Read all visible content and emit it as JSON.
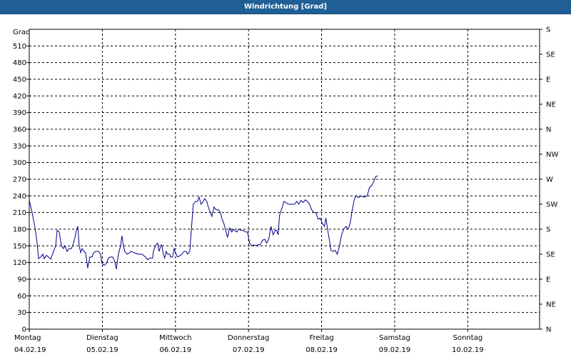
{
  "window": {
    "title": "Windrichtung [Grad]"
  },
  "colors": {
    "titlebar": "#1f5f95",
    "line": "#00008b",
    "grid": "#000000",
    "background": "#ffffff"
  },
  "chart_data": {
    "type": "line",
    "title": "Windrichtung [Grad]",
    "ylabel": "Grad",
    "ylim": [
      0,
      540
    ],
    "yticks": [
      0,
      30,
      60,
      90,
      120,
      150,
      180,
      210,
      240,
      270,
      300,
      330,
      360,
      390,
      420,
      450,
      480,
      510
    ],
    "right_ticks": [
      {
        "value": 0,
        "label": "N"
      },
      {
        "value": 45,
        "label": "NE"
      },
      {
        "value": 90,
        "label": "E"
      },
      {
        "value": 135,
        "label": "SE"
      },
      {
        "value": 180,
        "label": "S"
      },
      {
        "value": 225,
        "label": "SW"
      },
      {
        "value": 270,
        "label": "W"
      },
      {
        "value": 315,
        "label": "NW"
      },
      {
        "value": 360,
        "label": "N"
      },
      {
        "value": 405,
        "label": "NE"
      },
      {
        "value": 450,
        "label": "E"
      },
      {
        "value": 495,
        "label": "SE"
      },
      {
        "value": 540,
        "label": "S"
      }
    ],
    "xlim": [
      0,
      7
    ],
    "x_unit": "days",
    "x_labels": [
      {
        "day": "Montag",
        "date": "04.02.19"
      },
      {
        "day": "Dienstag",
        "date": "05.02.19"
      },
      {
        "day": "Mittwoch",
        "date": "06.02.19"
      },
      {
        "day": "Donnerstag",
        "date": "07.02.19"
      },
      {
        "day": "Freitag",
        "date": "08.02.19"
      },
      {
        "day": "Samstag",
        "date": "09.02.19"
      },
      {
        "day": "Sonntag",
        "date": "10.02.19"
      }
    ],
    "grid": true,
    "series": [
      {
        "values": [
          [
            0.0,
            232
          ],
          [
            0.039,
            210
          ],
          [
            0.078,
            183
          ],
          [
            0.107,
            155
          ],
          [
            0.127,
            127
          ],
          [
            0.156,
            130
          ],
          [
            0.185,
            135
          ],
          [
            0.205,
            127
          ],
          [
            0.234,
            133
          ],
          [
            0.263,
            130
          ],
          [
            0.293,
            126
          ],
          [
            0.332,
            140
          ],
          [
            0.361,
            150
          ],
          [
            0.381,
            178
          ],
          [
            0.41,
            175
          ],
          [
            0.439,
            150
          ],
          [
            0.468,
            145
          ],
          [
            0.488,
            150
          ],
          [
            0.517,
            140
          ],
          [
            0.546,
            145
          ],
          [
            0.576,
            145
          ],
          [
            0.605,
            155
          ],
          [
            0.625,
            165
          ],
          [
            0.644,
            178
          ],
          [
            0.664,
            185
          ],
          [
            0.683,
            150
          ],
          [
            0.703,
            138
          ],
          [
            0.722,
            145
          ],
          [
            0.751,
            140
          ],
          [
            0.771,
            137
          ],
          [
            0.8,
            110
          ],
          [
            0.829,
            130
          ],
          [
            0.859,
            130
          ],
          [
            0.878,
            137
          ],
          [
            0.907,
            140
          ],
          [
            0.946,
            140
          ],
          [
            0.976,
            135
          ],
          [
            0.995,
            118
          ],
          [
            1.024,
            115
          ],
          [
            1.053,
            118
          ],
          [
            1.083,
            128
          ],
          [
            1.112,
            130
          ],
          [
            1.141,
            130
          ],
          [
            1.171,
            122
          ],
          [
            1.19,
            108
          ],
          [
            1.22,
            135
          ],
          [
            1.249,
            150
          ],
          [
            1.268,
            168
          ],
          [
            1.288,
            150
          ],
          [
            1.307,
            140
          ],
          [
            1.337,
            135
          ],
          [
            1.366,
            137
          ],
          [
            1.395,
            140
          ],
          [
            1.444,
            137
          ],
          [
            1.493,
            135
          ],
          [
            1.542,
            135
          ],
          [
            1.59,
            130
          ],
          [
            1.62,
            125
          ],
          [
            1.649,
            128
          ],
          [
            1.688,
            128
          ],
          [
            1.698,
            140
          ],
          [
            1.727,
            150
          ],
          [
            1.756,
            155
          ],
          [
            1.776,
            140
          ],
          [
            1.805,
            152
          ],
          [
            1.815,
            150
          ],
          [
            1.834,
            135
          ],
          [
            1.854,
            128
          ],
          [
            1.873,
            140
          ],
          [
            1.893,
            135
          ],
          [
            1.922,
            135
          ],
          [
            1.932,
            130
          ],
          [
            1.961,
            130
          ],
          [
            1.981,
            145
          ],
          [
            2.0,
            138
          ],
          [
            2.029,
            130
          ],
          [
            2.059,
            132
          ],
          [
            2.088,
            135
          ],
          [
            2.117,
            140
          ],
          [
            2.146,
            140
          ],
          [
            2.166,
            135
          ],
          [
            2.195,
            140
          ],
          [
            2.244,
            225
          ],
          [
            2.273,
            230
          ],
          [
            2.302,
            230
          ],
          [
            2.322,
            238
          ],
          [
            2.351,
            225
          ],
          [
            2.38,
            230
          ],
          [
            2.4,
            235
          ],
          [
            2.429,
            230
          ],
          [
            2.449,
            220
          ],
          [
            2.478,
            210
          ],
          [
            2.498,
            203
          ],
          [
            2.527,
            220
          ],
          [
            2.556,
            215
          ],
          [
            2.585,
            215
          ],
          [
            2.615,
            210
          ],
          [
            2.634,
            200
          ],
          [
            2.663,
            190
          ],
          [
            2.693,
            175
          ],
          [
            2.712,
            165
          ],
          [
            2.741,
            182
          ],
          [
            2.771,
            175
          ],
          [
            2.79,
            180
          ],
          [
            2.81,
            178
          ],
          [
            2.839,
            175
          ],
          [
            2.868,
            180
          ],
          [
            2.898,
            178
          ],
          [
            2.927,
            178
          ],
          [
            2.956,
            175
          ],
          [
            2.985,
            175
          ],
          [
            3.015,
            155
          ],
          [
            3.044,
            150
          ],
          [
            3.073,
            152
          ],
          [
            3.102,
            150
          ],
          [
            3.132,
            152
          ],
          [
            3.161,
            152
          ],
          [
            3.19,
            160
          ],
          [
            3.22,
            162
          ],
          [
            3.249,
            155
          ],
          [
            3.278,
            163
          ],
          [
            3.307,
            185
          ],
          [
            3.337,
            170
          ],
          [
            3.366,
            178
          ],
          [
            3.385,
            178
          ],
          [
            3.405,
            170
          ],
          [
            3.424,
            205
          ],
          [
            3.463,
            220
          ],
          [
            3.483,
            230
          ],
          [
            3.512,
            228
          ],
          [
            3.541,
            225
          ],
          [
            3.571,
            225
          ],
          [
            3.6,
            225
          ],
          [
            3.629,
            225
          ],
          [
            3.659,
            230
          ],
          [
            3.688,
            225
          ],
          [
            3.717,
            232
          ],
          [
            3.746,
            228
          ],
          [
            3.776,
            233
          ],
          [
            3.805,
            230
          ],
          [
            3.834,
            225
          ],
          [
            3.863,
            215
          ],
          [
            3.893,
            210
          ],
          [
            3.922,
            210
          ],
          [
            3.951,
            198
          ],
          [
            3.98,
            200
          ],
          [
            4.01,
            190
          ],
          [
            4.039,
            185
          ],
          [
            4.059,
            200
          ],
          [
            4.088,
            175
          ],
          [
            4.107,
            160
          ],
          [
            4.127,
            142
          ],
          [
            4.156,
            140
          ],
          [
            4.185,
            142
          ],
          [
            4.215,
            135
          ],
          [
            4.244,
            150
          ],
          [
            4.273,
            170
          ],
          [
            4.302,
            180
          ],
          [
            4.332,
            185
          ],
          [
            4.361,
            180
          ],
          [
            4.39,
            190
          ],
          [
            4.42,
            215
          ],
          [
            4.449,
            235
          ],
          [
            4.478,
            240
          ],
          [
            4.507,
            237
          ],
          [
            4.537,
            240
          ],
          [
            4.566,
            238
          ],
          [
            4.595,
            238
          ],
          [
            4.624,
            240
          ],
          [
            4.654,
            255
          ],
          [
            4.683,
            258
          ],
          [
            4.712,
            265
          ],
          [
            4.741,
            275
          ],
          [
            4.771,
            276
          ]
        ]
      }
    ]
  }
}
